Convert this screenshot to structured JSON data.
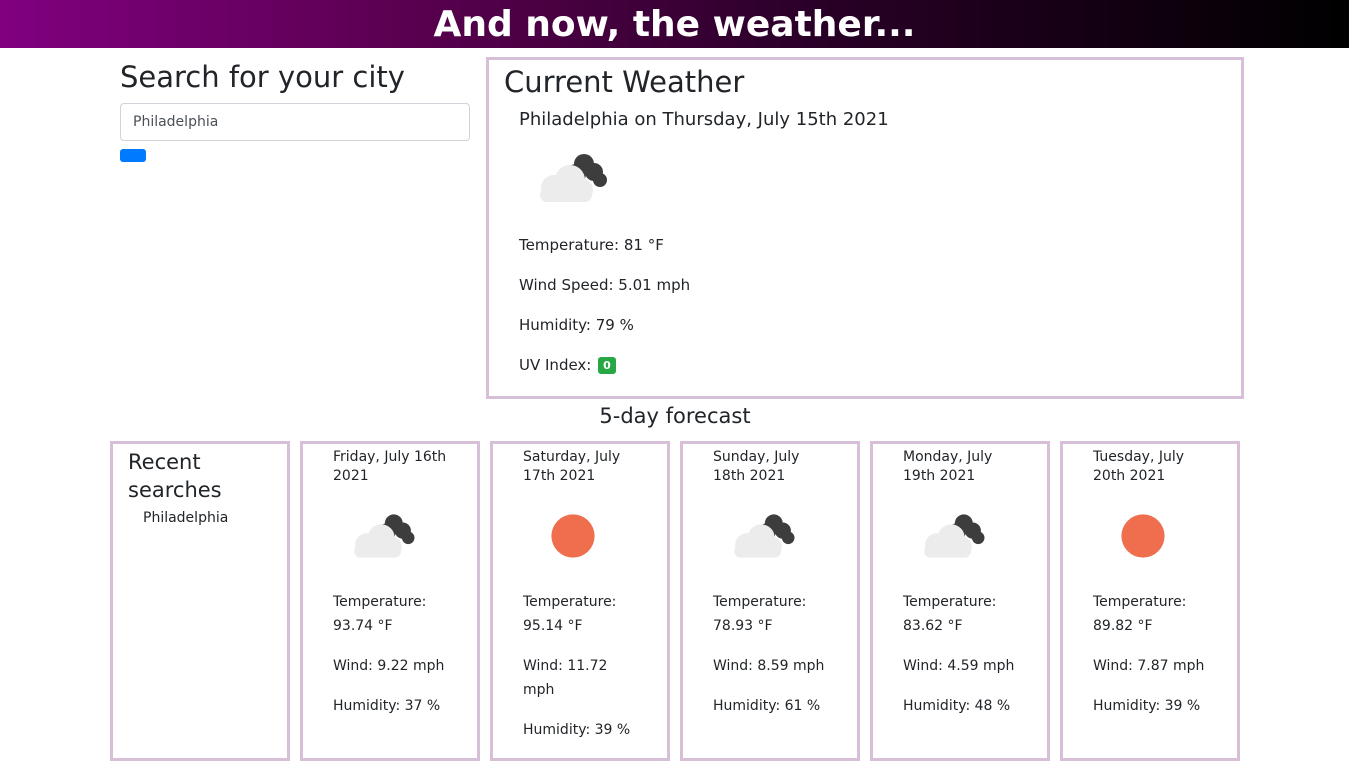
{
  "banner": {
    "title": "And now, the weather..."
  },
  "search": {
    "title": "Search for your city",
    "input_value": "Philadelphia",
    "button_color": "#007bff"
  },
  "current": {
    "title": "Current Weather",
    "heading": "Philadelphia on Thursday, July 15th 2021",
    "icon": "cloudy-icon",
    "temperature": "Temperature: 81 °F",
    "wind": "Wind Speed: 5.01 mph",
    "humidity": "Humidity: 79 %",
    "uv_label": "UV Index:",
    "uv_value": "0",
    "uv_color": "#28a745"
  },
  "forecast": {
    "heading": "5-day forecast",
    "days": [
      {
        "date": "Friday, July 16th 2021",
        "icon": "cloudy-icon",
        "temp_label": "Temperature:",
        "temp": "93.74 °F",
        "wind": "Wind: 9.22 mph",
        "humidity": "Humidity: 37 %"
      },
      {
        "date": "Saturday, July 17th 2021",
        "icon": "sun-icon",
        "temp_label": "Temperature:",
        "temp": "95.14 °F",
        "wind": "Wind: 11.72 mph",
        "humidity": "Humidity: 39 %"
      },
      {
        "date": "Sunday, July 18th 2021",
        "icon": "cloudy-icon",
        "temp_label": "Temperature:",
        "temp": "78.93 °F",
        "wind": "Wind: 8.59 mph",
        "humidity": "Humidity: 61 %"
      },
      {
        "date": "Monday, July 19th 2021",
        "icon": "cloudy-icon",
        "temp_label": "Temperature:",
        "temp": "83.62 °F",
        "wind": "Wind: 4.59 mph",
        "humidity": "Humidity: 48 %"
      },
      {
        "date": "Tuesday, July 20th 2021",
        "icon": "sun-icon",
        "temp_label": "Temperature:",
        "temp": "89.82 °F",
        "wind": "Wind: 7.87 mph",
        "humidity": "Humidity: 39 %"
      }
    ]
  },
  "recent": {
    "title": "Recent searches",
    "items": [
      "Philadelphia"
    ]
  },
  "colors": {
    "border": "#d8bfd8",
    "sun": "#ee6e4d"
  }
}
